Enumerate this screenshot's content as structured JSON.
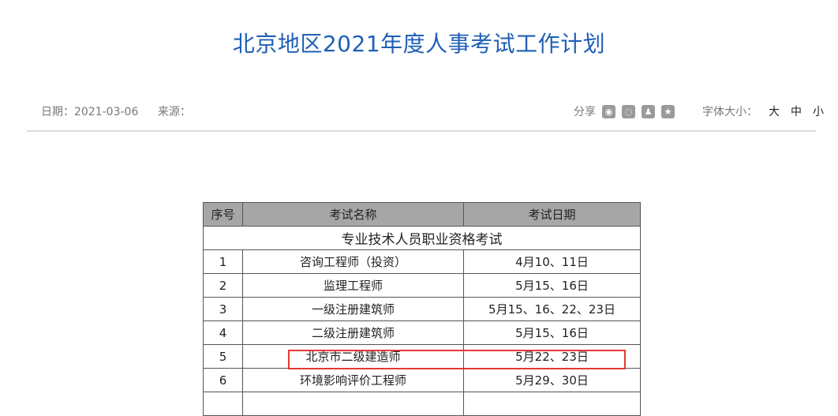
{
  "page": {
    "title": "北京地区2021年度人事考试工作计划",
    "date_label": "日期：2021-03-06",
    "source_label": "来源：",
    "share_label": "分享",
    "share_icons": [
      "weibo-icon",
      "wechat-icon",
      "qq-icon",
      "qzone-icon"
    ],
    "font_size_label": "字体大小：",
    "font_sizes": [
      "大",
      "中",
      "小"
    ]
  },
  "table": {
    "headers": [
      "序号",
      "考试名称",
      "考试日期"
    ],
    "section": "专业技术人员职业资格考试",
    "rows": [
      {
        "no": "1",
        "name": "咨询工程师（投资）",
        "date": "4月10、11日"
      },
      {
        "no": "2",
        "name": "监理工程师",
        "date": "5月15、16日"
      },
      {
        "no": "3",
        "name": "一级注册建筑师",
        "date": "5月15、16、22、23日"
      },
      {
        "no": "4",
        "name": "二级注册建筑师",
        "date": "5月15、16日"
      },
      {
        "no": "5",
        "name": "北京市二级建造师",
        "date": "5月22、23日"
      },
      {
        "no": "6",
        "name": "环境影响评价工程师",
        "date": "5月29、30日"
      }
    ]
  },
  "colors": {
    "title": "#1f5fb7",
    "header_bg": "#a6a6a6",
    "highlight": "#e53935"
  }
}
